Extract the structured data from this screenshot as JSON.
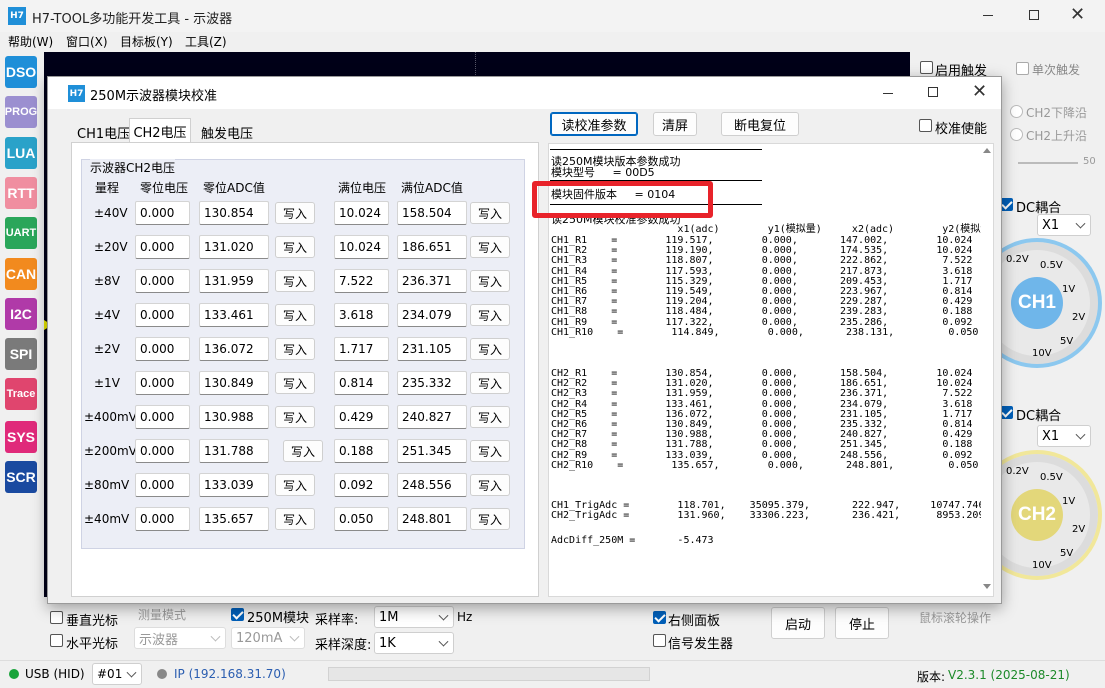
{
  "app": {
    "title": "H7-TOOL多功能开发工具 - 示波器",
    "icon_text": "H7"
  },
  "menu": [
    "帮助(W)",
    "窗口(X)",
    "目标板(Y)",
    "工具(Z)"
  ],
  "sidebar": [
    {
      "label": "DSO",
      "color": "#1f8fd8"
    },
    {
      "label": "PROG",
      "color": "#9b8fd0"
    },
    {
      "label": "LUA",
      "color": "#2aa2c9"
    },
    {
      "label": "RTT",
      "color": "#f08ea0"
    },
    {
      "label": "UART",
      "color": "#2aa65a"
    },
    {
      "label": "CAN",
      "color": "#f28a1e"
    },
    {
      "label": "I2C",
      "color": "#b03aa8"
    },
    {
      "label": "SPI",
      "color": "#7a7a7a"
    },
    {
      "label": "Trace",
      "color": "#e0456e"
    },
    {
      "label": "SYS",
      "color": "#e02a7a"
    },
    {
      "label": "SCR",
      "color": "#1a4aa0"
    }
  ],
  "right_panel": {
    "trigger_enable": "启用触发",
    "single_trigger": "单次触发",
    "ch2_falling": "CH2下降沿",
    "ch2_rising": "CH2上升沿",
    "slider_max": "50",
    "dc_coupling_1": "DC耦合",
    "dc_coupling_2": "DC耦合",
    "probe_1": "X1",
    "probe_2": "X1",
    "knob1_label": "CH1",
    "knob2_label": "CH2",
    "knob_ticks": [
      "0.2V",
      "0.5V",
      "1V",
      "2V",
      "5V",
      "10V"
    ]
  },
  "bottom": {
    "vertical_cursor": "垂直光标",
    "horizontal_cursor": "水平光标",
    "measure_mode": "测量模式",
    "module_250m": "250M模块",
    "sample_rate_label": "采样率:",
    "sample_rate": "1M",
    "hz": "Hz",
    "sample_depth_label": "采样深度:",
    "sample_depth": "1K",
    "mode": "示波器",
    "current": "120mA",
    "right_panel_chk": "右侧面板",
    "signal_gen": "信号发生器",
    "start": "启动",
    "stop": "停止",
    "mouse_wheel": "鼠标滚轮操作"
  },
  "status": {
    "usb": "USB (HID)",
    "device": "#01",
    "ip": "IP (192.168.31.70)",
    "version_label": "版本:",
    "version": "V2.3.1 (2025-08-21)"
  },
  "dialog": {
    "title": "250M示波器模块校准",
    "icon_text": "H7",
    "tabs": [
      "CH1电压",
      "CH2电压",
      "触发电压"
    ],
    "group_title": "示波器CH2电压",
    "headers": {
      "range": "量程",
      "zero_v": "零位电压",
      "zero_adc": "零位ADC值",
      "full_v": "满位电压",
      "full_adc": "满位ADC值"
    },
    "write_label": "写入",
    "rows": [
      {
        "range": "±40V",
        "zero_v": "0.000",
        "zero_adc": "130.854",
        "full_v": "10.024",
        "full_adc": "158.504"
      },
      {
        "range": "±20V",
        "zero_v": "0.000",
        "zero_adc": "131.020",
        "full_v": "10.024",
        "full_adc": "186.651"
      },
      {
        "range": "±8V",
        "zero_v": "0.000",
        "zero_adc": "131.959",
        "full_v": "7.522",
        "full_adc": "236.371"
      },
      {
        "range": "±4V",
        "zero_v": "0.000",
        "zero_adc": "133.461",
        "full_v": "3.618",
        "full_adc": "234.079"
      },
      {
        "range": "±2V",
        "zero_v": "0.000",
        "zero_adc": "136.072",
        "full_v": "1.717",
        "full_adc": "231.105"
      },
      {
        "range": "±1V",
        "zero_v": "0.000",
        "zero_adc": "130.849",
        "full_v": "0.814",
        "full_adc": "235.332"
      },
      {
        "range": "±400mV",
        "zero_v": "0.000",
        "zero_adc": "130.988",
        "full_v": "0.429",
        "full_adc": "240.827"
      },
      {
        "range": "±200mV",
        "zero_v": "0.000",
        "zero_adc": "131.788",
        "full_v": "0.188",
        "full_adc": "251.345"
      },
      {
        "range": "±80mV",
        "zero_v": "0.000",
        "zero_adc": "133.039",
        "full_v": "0.092",
        "full_adc": "248.556"
      },
      {
        "range": "±40mV",
        "zero_v": "0.000",
        "zero_adc": "135.657",
        "full_v": "0.050",
        "full_adc": "248.801"
      }
    ],
    "buttons": {
      "read": "读校准参数",
      "clear": "清屏",
      "reset": "断电复位",
      "calib_enable": "校准使能"
    },
    "log": {
      "l1": "读250M模块版本参数成功",
      "l2": "模块型号     = 00D5",
      "l3": "模块固件版本     = 0104",
      "l4": "读250M模块校准参数成功",
      "hdr": "                     x1(adc)        y1(模拟量)     x2(adc)        y2(模拟量)",
      "ch1": [
        "CH1_R1    =        119.517,        0.000,       147.002,        10.024",
        "CH1_R2    =        119.190,        0.000,       174.535,        10.024",
        "CH1_R3    =        118.807,        0.000,       222.862,         7.522",
        "CH1_R4    =        117.593,        0.000,       217.873,         3.618",
        "CH1_R5    =        115.329,        0.000,       209.453,         1.717",
        "CH1_R6    =        119.549,        0.000,       223.967,         0.814",
        "CH1_R7    =        119.204,        0.000,       229.287,         0.429",
        "CH1_R8    =        118.484,        0.000,       239.283,         0.188",
        "CH1_R9    =        117.322,        0.000,       235.286,         0.092",
        "CH1_R10    =        114.849,        0.000,       238.131,         0.050"
      ],
      "ch2": [
        "CH2_R1    =        130.854,        0.000,       158.504,        10.024",
        "CH2_R2    =        131.020,        0.000,       186.651,        10.024",
        "CH2_R3    =        131.959,        0.000,       236.371,         7.522",
        "CH2_R4    =        133.461,        0.000,       234.079,         3.618",
        "CH2_R5    =        136.072,        0.000,       231.105,         1.717",
        "CH2_R6    =        130.849,        0.000,       235.332,         0.814",
        "CH2_R7    =        130.988,        0.000,       240.827,         0.429",
        "CH2_R8    =        131.788,        0.000,       251.345,         0.188",
        "CH2_R9    =        133.039,        0.000,       248.556,         0.092",
        "CH2_R10    =        135.657,        0.000,       248.801,         0.050"
      ],
      "trig": [
        "CH1_TrigAdc =        118.701,    35095.379,       222.947,     10747.746",
        "CH2_TrigAdc =        131.960,    33306.223,       236.421,      8953.209"
      ],
      "diff": "AdcDiff_250M =       -5.473"
    },
    "highlight_color": "#e8232a"
  }
}
